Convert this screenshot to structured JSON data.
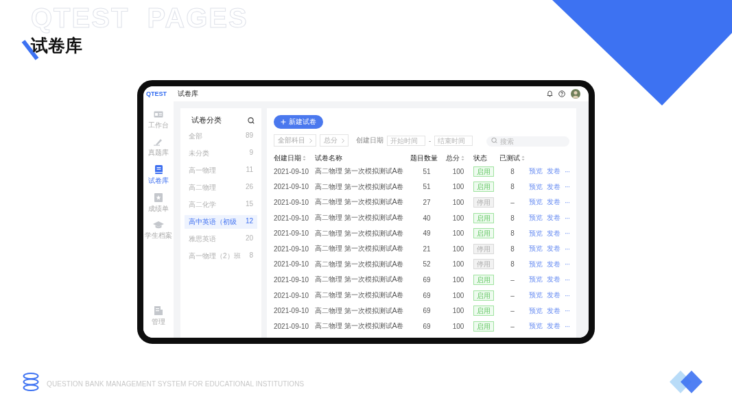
{
  "slide": {
    "watermark": "QTEST  PAGES",
    "title": "试卷库",
    "footer": "QUESTION BANK MANAGEMENT SYSTEM FOR EDUCATIONAL INSTITUTIONS"
  },
  "app": {
    "logo": "QTEST",
    "page_title": "试卷库"
  },
  "nav": [
    {
      "label": "工作台",
      "kind": "desk",
      "selected": false
    },
    {
      "label": "真题库",
      "kind": "pen",
      "selected": false
    },
    {
      "label": "试卷库",
      "kind": "book",
      "selected": true
    },
    {
      "label": "成绩单",
      "kind": "star",
      "selected": false
    },
    {
      "label": "学生档案",
      "kind": "cap",
      "selected": false
    }
  ],
  "nav_bottom": {
    "label": "管理",
    "kind": "building",
    "selected": false
  },
  "categories": {
    "title": "试卷分类",
    "items": [
      {
        "label": "全部",
        "count": "89",
        "selected": false
      },
      {
        "label": "未分类",
        "count": "9",
        "selected": false
      },
      {
        "label": "高一物理",
        "count": "11",
        "selected": false
      },
      {
        "label": "高二物理",
        "count": "26",
        "selected": false
      },
      {
        "label": "高二化学",
        "count": "15",
        "selected": false
      },
      {
        "label": "高中英语（初级",
        "count": "12",
        "selected": true
      },
      {
        "label": "雅思英语",
        "count": "20",
        "selected": false
      },
      {
        "label": "高一物理（2）班",
        "count": "8",
        "selected": false
      }
    ]
  },
  "toolbar": {
    "new_button": "新建试卷",
    "filters": [
      "全部科目",
      "总分"
    ],
    "date_label": "创建日期",
    "start_placeholder": "开始时间",
    "separator": "-",
    "end_placeholder": "结束时间",
    "search_placeholder": "搜索"
  },
  "table": {
    "columns": [
      {
        "label": "创建日期",
        "sortable": true
      },
      {
        "label": "试卷名称",
        "sortable": false
      },
      {
        "label": "题目数量",
        "sortable": false
      },
      {
        "label": "总分",
        "sortable": true
      },
      {
        "label": "状态",
        "sortable": false
      },
      {
        "label": "已测试",
        "sortable": true
      }
    ],
    "rows": [
      {
        "date": "2021-09-10",
        "name": "高二物理 第一次模拟测试A卷",
        "count": "51",
        "total": "100",
        "status": "启用",
        "enabled": true,
        "tested": "8",
        "actions": [
          "预览",
          "发卷"
        ],
        "more": "···"
      },
      {
        "date": "2021-09-10",
        "name": "高二物理 第一次模拟测试A卷",
        "count": "51",
        "total": "100",
        "status": "启用",
        "enabled": true,
        "tested": "8",
        "actions": [
          "预览",
          "发卷"
        ],
        "more": "···"
      },
      {
        "date": "2021-09-10",
        "name": "高二物理 第一次模拟测试A卷",
        "count": "27",
        "total": "100",
        "status": "停用",
        "enabled": false,
        "tested": "–",
        "actions": [
          "预览",
          "发卷"
        ],
        "more": "···"
      },
      {
        "date": "2021-09-10",
        "name": "高二物理 第一次模拟测试A卷",
        "count": "40",
        "total": "100",
        "status": "启用",
        "enabled": true,
        "tested": "8",
        "actions": [
          "预览",
          "发卷"
        ],
        "more": "···"
      },
      {
        "date": "2021-09-10",
        "name": "高二物理 第一次模拟测试A卷",
        "count": "49",
        "total": "100",
        "status": "启用",
        "enabled": true,
        "tested": "8",
        "actions": [
          "预览",
          "发卷"
        ],
        "more": "···"
      },
      {
        "date": "2021-09-10",
        "name": "高二物理 第一次模拟测试A卷",
        "count": "21",
        "total": "100",
        "status": "停用",
        "enabled": false,
        "tested": "8",
        "actions": [
          "预览",
          "发卷"
        ],
        "more": "···"
      },
      {
        "date": "2021-09-10",
        "name": "高二物理 第一次模拟测试A卷",
        "count": "52",
        "total": "100",
        "status": "停用",
        "enabled": false,
        "tested": "8",
        "actions": [
          "预览",
          "发卷"
        ],
        "more": "···"
      },
      {
        "date": "2021-09-10",
        "name": "高二物理 第一次模拟测试A卷",
        "count": "69",
        "total": "100",
        "status": "启用",
        "enabled": true,
        "tested": "–",
        "actions": [
          "预览",
          "发卷"
        ],
        "more": "···"
      },
      {
        "date": "2021-09-10",
        "name": "高二物理 第一次模拟测试A卷",
        "count": "69",
        "total": "100",
        "status": "启用",
        "enabled": true,
        "tested": "–",
        "actions": [
          "预览",
          "发卷"
        ],
        "more": "···"
      },
      {
        "date": "2021-09-10",
        "name": "高二物理 第一次模拟测试A卷",
        "count": "69",
        "total": "100",
        "status": "启用",
        "enabled": true,
        "tested": "–",
        "actions": [
          "预览",
          "发卷"
        ],
        "more": "···"
      },
      {
        "date": "2021-09-10",
        "name": "高二物理 第一次模拟测试A卷",
        "count": "69",
        "total": "100",
        "status": "启用",
        "enabled": true,
        "tested": "–",
        "actions": [
          "预览",
          "发卷"
        ],
        "more": "···"
      }
    ]
  }
}
